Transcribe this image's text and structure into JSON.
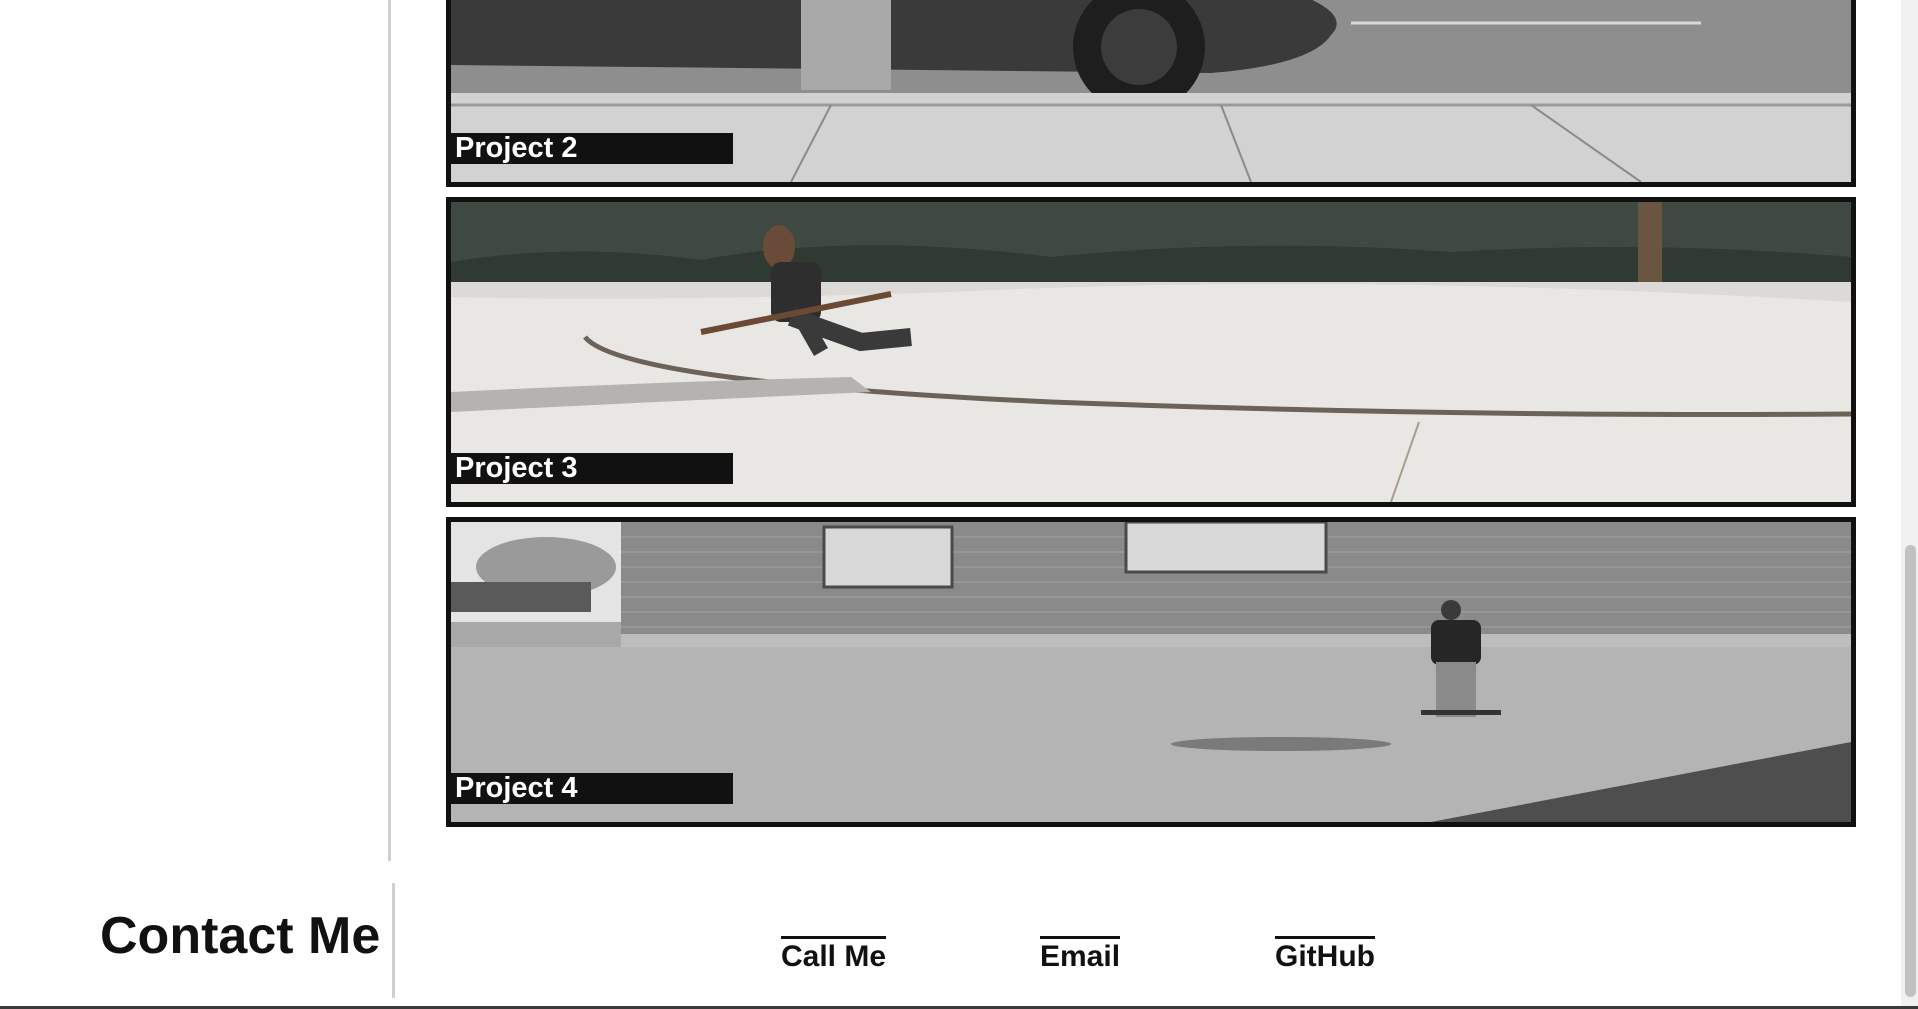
{
  "projects": [
    {
      "id": "card-2",
      "label": "Project 2",
      "scene": "street-car"
    },
    {
      "id": "card-3",
      "label": "Project 3",
      "scene": "skate-curb"
    },
    {
      "id": "card-4",
      "label": "Project 4",
      "scene": "brick-wall"
    }
  ],
  "contact": {
    "title": "Contact Me",
    "links": [
      {
        "label": "Call Me"
      },
      {
        "label": "Email"
      },
      {
        "label": "GitHub"
      }
    ]
  },
  "colors": {
    "border": "#111111",
    "label_bg": "#111111",
    "label_text": "#ffffff",
    "divider": "#d0d0d0",
    "text": "#111111"
  }
}
